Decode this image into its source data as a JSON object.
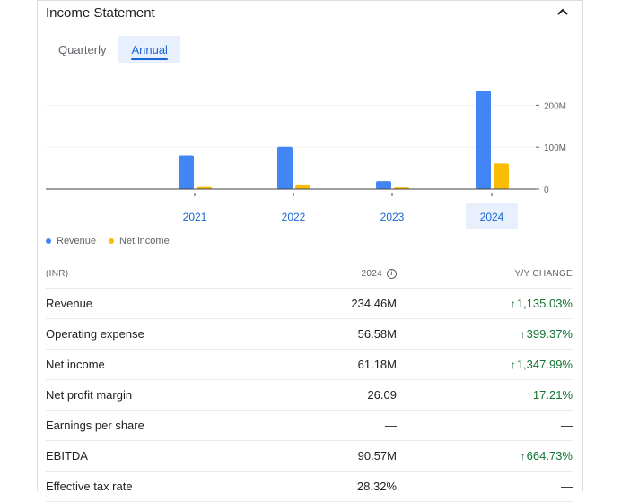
{
  "header": {
    "title": "Income Statement",
    "collapse_icon": "chevron-up-icon"
  },
  "tabs": [
    {
      "label": "Quarterly",
      "active": false
    },
    {
      "label": "Annual",
      "active": true
    }
  ],
  "colors": {
    "revenue": "#4285f4",
    "net_income": "#fbbc04",
    "positive": "#137333",
    "accent": "#1967d2"
  },
  "chart_data": {
    "type": "bar",
    "categories": [
      "2021",
      "2022",
      "2023",
      "2024"
    ],
    "series": [
      {
        "name": "Revenue",
        "values": [
          80,
          101,
          19,
          234.46
        ]
      },
      {
        "name": "Net income",
        "values": [
          5,
          11,
          4,
          61.18
        ]
      }
    ],
    "yticks": [
      "0",
      "100M",
      "200M"
    ],
    "ylim": [
      0,
      235
    ],
    "selected_category": "2024",
    "legend_position": "bottom-left"
  },
  "legend": [
    {
      "label": "Revenue"
    },
    {
      "label": "Net income"
    }
  ],
  "table": {
    "headers": {
      "metric": "(INR)",
      "year": "2024",
      "change": "Y/Y CHANGE"
    },
    "rows": [
      {
        "metric": "Revenue",
        "value": "234.46M",
        "change": "1,135.03%",
        "trend": "up"
      },
      {
        "metric": "Operating expense",
        "value": "56.58M",
        "change": "399.37%",
        "trend": "up"
      },
      {
        "metric": "Net income",
        "value": "61.18M",
        "change": "1,347.99%",
        "trend": "up"
      },
      {
        "metric": "Net profit margin",
        "value": "26.09",
        "change": "17.21%",
        "trend": "up"
      },
      {
        "metric": "Earnings per share",
        "value": "—",
        "change": "—",
        "trend": "none"
      },
      {
        "metric": "EBITDA",
        "value": "90.57M",
        "change": "664.73%",
        "trend": "up"
      },
      {
        "metric": "Effective tax rate",
        "value": "28.32%",
        "change": "—",
        "trend": "none"
      }
    ]
  }
}
